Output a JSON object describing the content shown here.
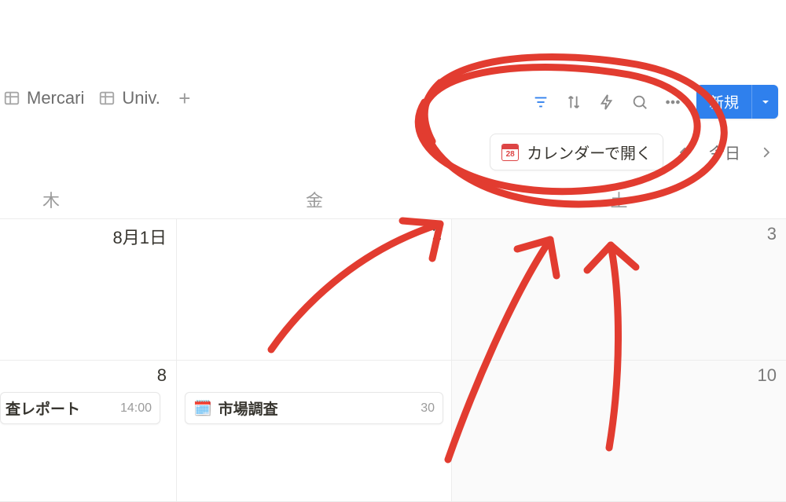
{
  "tabs": {
    "items": [
      {
        "label": "Mercari"
      },
      {
        "label": "Univ."
      }
    ]
  },
  "toolbar": {
    "new_label": "新規"
  },
  "subbar": {
    "open_calendar_label": "カレンダーで開く",
    "cal_icon_day": "28",
    "today_label": "今日"
  },
  "weekdays": {
    "thu": "木",
    "fri": "金",
    "sat": "土"
  },
  "grid": {
    "row1": {
      "thu": {
        "date": "8月1日"
      },
      "fri": {
        "date": "2"
      },
      "sat": {
        "date": "3"
      }
    },
    "row2": {
      "thu": {
        "date": "8",
        "event": {
          "title": "査レポート",
          "time": "14:00"
        }
      },
      "fri": {
        "date": "",
        "event": {
          "emoji": "🗓️",
          "title": "市場調査",
          "time": "30"
        }
      },
      "sat": {
        "date": "10"
      }
    }
  }
}
